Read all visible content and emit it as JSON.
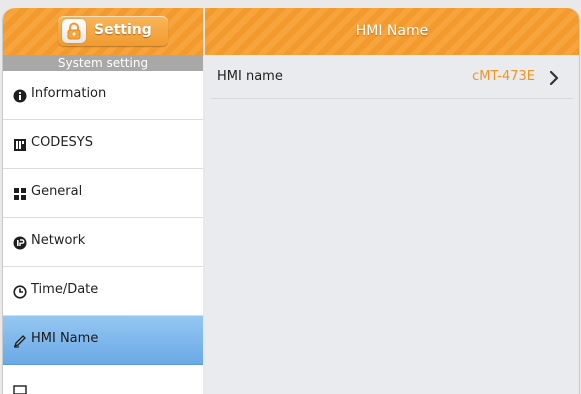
{
  "app": {
    "title": "Setting",
    "section": "System setting"
  },
  "sidebar": {
    "items": [
      {
        "label": "Information",
        "icon": "info-circle-icon",
        "active": false
      },
      {
        "label": "CODESYS",
        "icon": "codesys-icon",
        "active": false
      },
      {
        "label": "General",
        "icon": "grid-icon",
        "active": false
      },
      {
        "label": "Network",
        "icon": "ip-icon",
        "active": false
      },
      {
        "label": "Time/Date",
        "icon": "clock-icon",
        "active": false
      },
      {
        "label": "HMI Name",
        "icon": "pen-icon",
        "active": true
      },
      {
        "label": "",
        "icon": "partial-item-icon",
        "active": false
      }
    ]
  },
  "main": {
    "title": "HMI Name",
    "rows": [
      {
        "label": "HMI name",
        "value": "cMT-473E"
      }
    ]
  },
  "colors": {
    "header_orange": "#f39a2e",
    "value_orange": "#f2951e",
    "active_blue": "#6aa9e6",
    "section_gray": "#a8a8a8"
  }
}
